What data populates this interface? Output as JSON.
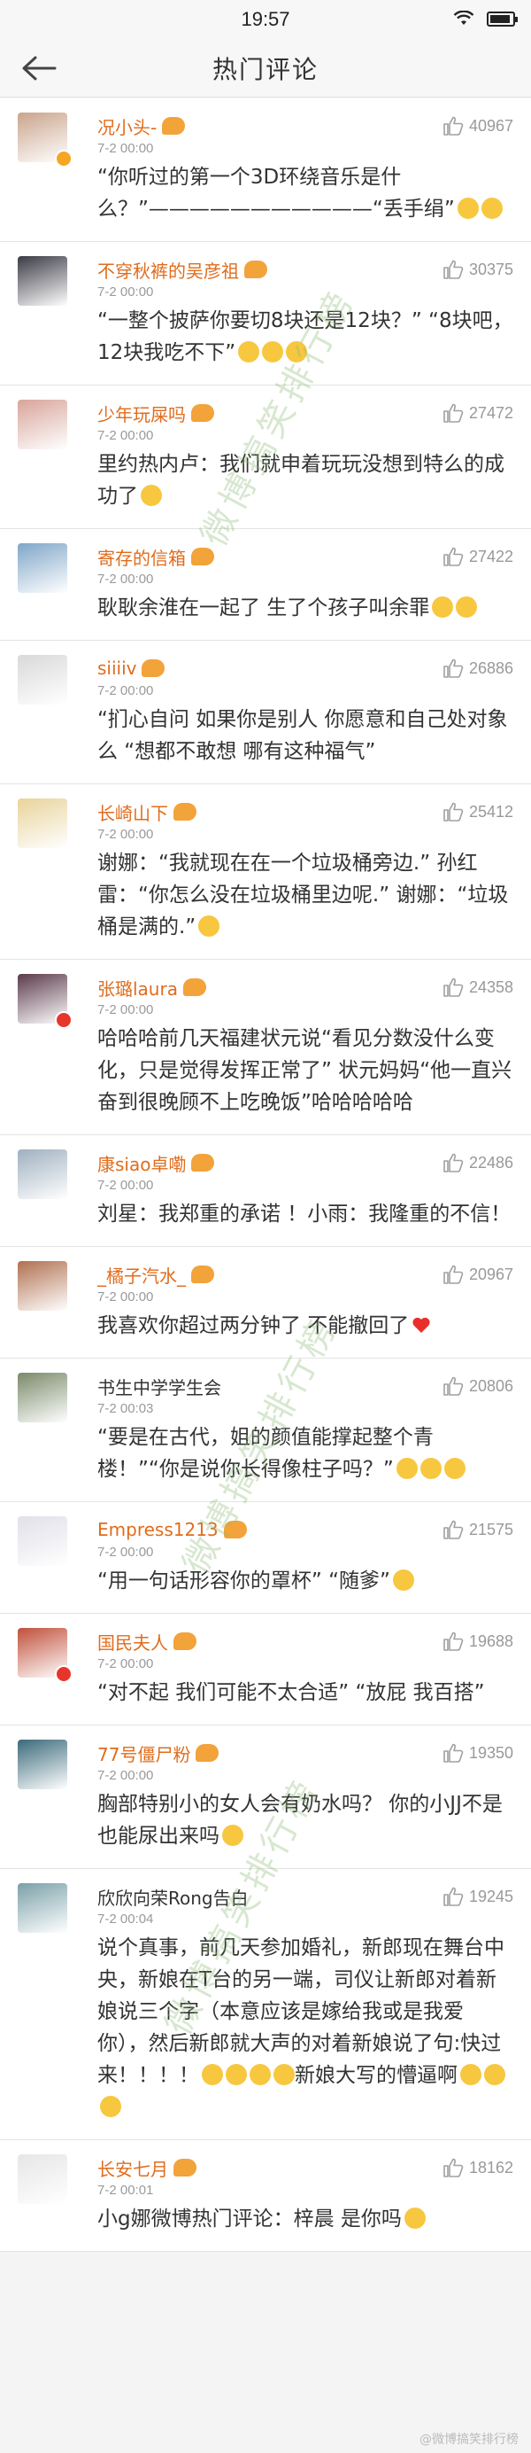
{
  "status_bar": {
    "time": "19:57",
    "wifi_icon": "wifi-icon",
    "battery_icon": "battery-icon",
    "battery_level": 0.9
  },
  "nav": {
    "title": "热门评论",
    "back_icon": "arrow-left-icon"
  },
  "comments": [
    {
      "name": "况小头-",
      "name_style": "orange",
      "rank": "rank-badge-icon",
      "verified": "gold",
      "likes": "40967",
      "time": "7-2 00:00",
      "text": "“你听过的第一个3D环绕音乐是什么？”———————————“丢手绢”",
      "emoji": [
        "smile-emoji",
        "smile-emoji"
      ]
    },
    {
      "name": "不穿秋裤的吴彦祖",
      "name_style": "orange",
      "rank": "rank-badge-icon",
      "likes": "30375",
      "time": "7-2 00:00",
      "text": "“一整个披萨你要切8块还是12块？” “8块吧，12块我吃不下”",
      "emoji": [
        "laugh-emoji",
        "laugh-emoji",
        "laugh-emoji"
      ]
    },
    {
      "name": "少年玩屎吗",
      "name_style": "orange",
      "rank": "rank-badge-icon",
      "likes": "27472",
      "time": "7-2 00:00",
      "text": "里约热内卢：我们就申着玩玩没想到特么的成功了",
      "emoji": [
        "smile-emoji"
      ]
    },
    {
      "name": "寄存的信箱",
      "name_style": "orange",
      "rank": "rank-badge-icon",
      "likes": "27422",
      "time": "7-2 00:00",
      "text": "耿耿余淮在一起了 生了个孩子叫余罪",
      "emoji": [
        "tears-emoji",
        "tears-emoji"
      ]
    },
    {
      "name": "siiiiv",
      "name_style": "orange",
      "rank": "rank-badge-icon",
      "likes": "26886",
      "time": "7-2 00:00",
      "text": "“扪心自问 如果你是别人 你愿意和自己处对象么 “想都不敢想 哪有这种福气”",
      "emoji": []
    },
    {
      "name": "长崎山下",
      "name_style": "orange",
      "rank": "rank-badge-icon",
      "likes": "25412",
      "time": "7-2 00:00",
      "text": "谢娜：“我就现在在一个垃圾桶旁边.” 孙红雷：“你怎么没在垃圾桶里边呢.” 谢娜：“垃圾桶是满的.”",
      "emoji": [
        "tears-emoji"
      ]
    },
    {
      "name": "张璐laura",
      "name_style": "orange",
      "rank": "rank-badge-icon",
      "verified": "red",
      "likes": "24358",
      "time": "7-2 00:00",
      "text": "哈哈哈前几天福建状元说“看见分数没什么变化，只是觉得发挥正常了” 状元妈妈“他一直兴奋到很晚顾不上吃晚饭”哈哈哈哈哈",
      "emoji": []
    },
    {
      "name": "康siao卓嘞",
      "name_style": "orange",
      "rank": "rank-badge-icon",
      "likes": "22486",
      "time": "7-2 00:00",
      "text": "刘星：我郑重的承诺 ！小雨：我隆重的不信！",
      "emoji": []
    },
    {
      "name": "_橘子汽水_",
      "name_style": "orange",
      "rank": "rank-badge-icon",
      "likes": "20967",
      "time": "7-2 00:00",
      "text": "我喜欢你超过两分钟了 不能撤回了",
      "emoji": [
        "heart-emoji"
      ]
    },
    {
      "name": "书生中学学生会",
      "name_style": "plain",
      "likes": "20806",
      "time": "7-2 00:03",
      "text": "“要是在古代，姐的颜值能撑起整个青楼！”“你是说你长得像柱子吗？”",
      "emoji": [
        "laugh-emoji",
        "laugh-emoji",
        "laugh-emoji"
      ]
    },
    {
      "name": "Empress1213",
      "name_style": "orange",
      "rank": "rank-badge-icon",
      "likes": "21575",
      "time": "7-2 00:00",
      "text": "“用一句话形容你的罩杯” “随爹”",
      "emoji": [
        "smile-emoji"
      ]
    },
    {
      "name": "国民夫人",
      "name_style": "orange",
      "rank": "rank-badge-icon",
      "verified": "red",
      "likes": "19688",
      "time": "7-2 00:00",
      "text": "“对不起 我们可能不太合适” “放屁 我百搭”",
      "emoji": []
    },
    {
      "name": "77号僵尸粉",
      "name_style": "orange",
      "rank": "rank-badge-icon",
      "likes": "19350",
      "time": "7-2 00:00",
      "text": "胸部特别小的女人会有奶水吗？ 你的小JJ不是也能尿出来吗",
      "emoji": [
        "tears-emoji"
      ]
    },
    {
      "name": "欣欣向荣Rong告白",
      "name_style": "plain",
      "likes": "19245",
      "time": "7-2 00:04",
      "text": "说个真事，前几天参加婚礼，新郎现在舞台中央，新娘在T台的另一端，司仪让新郎对着新娘说三个字（本意应该是嫁给我或是我爱你），然后新郎就大声的对着新娘说了句:快过来！！！！",
      "text2": "新娘大写的懵逼啊",
      "emoji": [
        "tears-emoji",
        "tears-emoji",
        "tears-emoji",
        "tears-emoji"
      ],
      "emoji2": [
        "smile-emoji",
        "smile-emoji",
        "smile-emoji"
      ]
    },
    {
      "name": "长安七月",
      "name_style": "orange",
      "rank": "rank-badge-icon",
      "likes": "18162",
      "time": "7-2 00:01",
      "text": "小g娜微博热门评论：梓晨 是你吗",
      "emoji": [
        "laugh-emoji"
      ]
    }
  ],
  "watermarks": [
    "微博搞笑排行榜",
    "微博搞笑排行榜",
    "微博搞笑排行榜"
  ],
  "footer": {
    "credit": "@微博搞笑排行榜"
  }
}
